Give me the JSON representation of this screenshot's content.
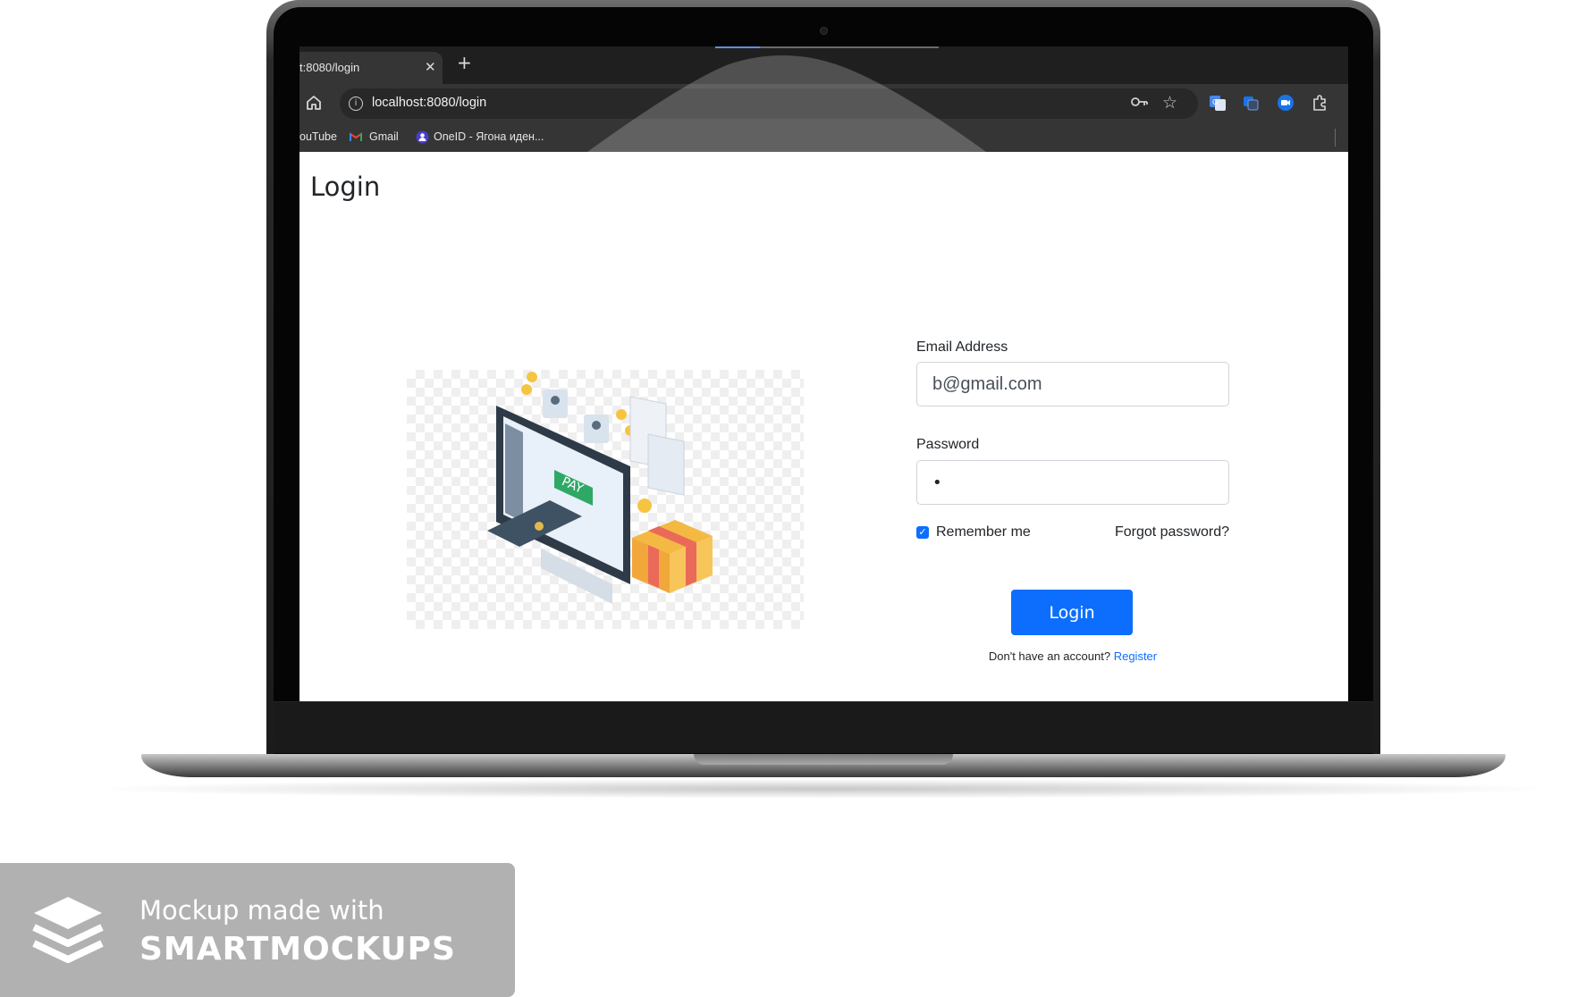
{
  "browser": {
    "tab_title": "t:8080/login",
    "tab_close_glyph": "✕",
    "new_tab_glyph": "+",
    "url": "localhost:8080/login",
    "bookmarks": [
      {
        "label": "ouTube",
        "icon": "youtube-icon"
      },
      {
        "label": "Gmail",
        "icon": "gmail-icon"
      },
      {
        "label": "OneID - Ягона иден...",
        "icon": "oneid-icon"
      }
    ],
    "icons": [
      "home-icon",
      "site-info-icon",
      "password-key-icon",
      "bookmark-star-icon",
      "google-translate-icon",
      "translate-extension-icon",
      "video-extension-icon",
      "extensions-puzzle-icon"
    ]
  },
  "page": {
    "title": "Login",
    "illustration_text": "PAY"
  },
  "login_form": {
    "email_label": "Email Address",
    "email_value": "b@gmail.com",
    "password_label": "Password",
    "password_value": "•",
    "remember_label": "Remember me",
    "remember_checked": true,
    "forgot_label": "Forgot password?",
    "submit_label": "Login",
    "register_prompt": "Don't have an account?",
    "register_link": "Register"
  },
  "watermark": {
    "line1": "Mockup made with",
    "line2": "SMARTMOCKUPS"
  },
  "colors": {
    "primary": "#0d6efd",
    "browser_dark": "#1f1f1f",
    "browser_toolbar": "#353535",
    "watermark_bg": "#b1b1b1"
  }
}
